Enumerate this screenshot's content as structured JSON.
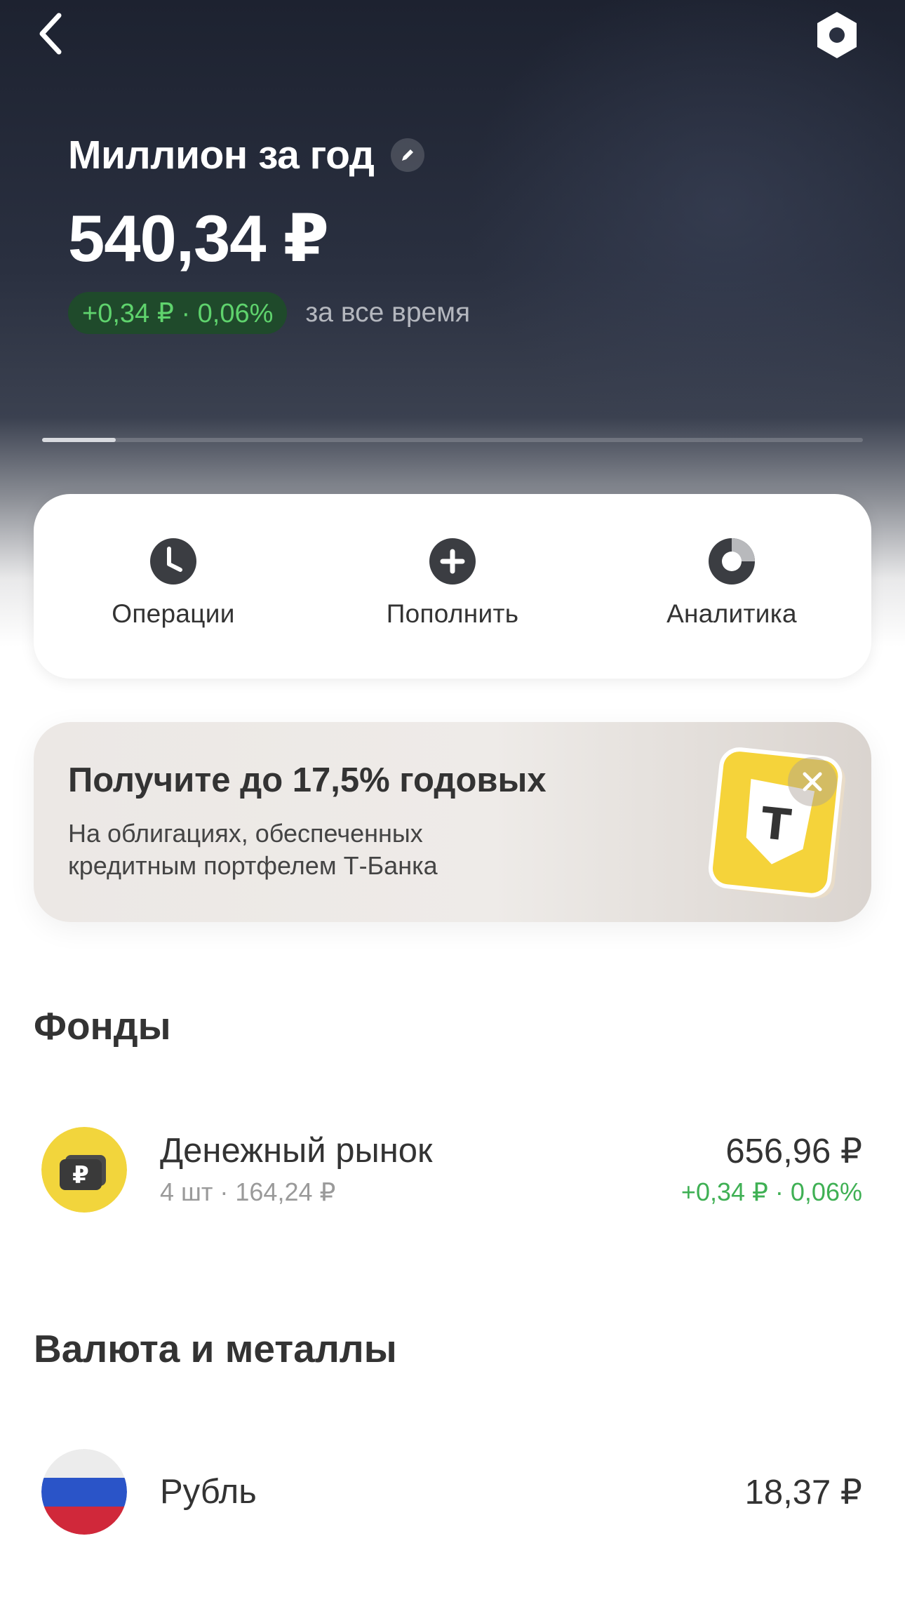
{
  "header": {
    "back_icon": "chevron-left-icon",
    "settings_icon": "hexagon-settings-icon",
    "title": "Миллион за год",
    "edit_icon": "pencil-icon",
    "balance": "540,34 ₽",
    "yield_badge": "+0,34 ₽ · 0,06%",
    "yield_period": "за все время",
    "progress_fraction": 0.09
  },
  "actions": [
    {
      "label": "Операции",
      "icon": "clock-icon"
    },
    {
      "label": "Пополнить",
      "icon": "plus-icon"
    },
    {
      "label": "Аналитика",
      "icon": "pie-chart-icon"
    }
  ],
  "promo": {
    "title": "Получите до 17,5% годовых",
    "text_line1": "На облигациях, обеспеченных",
    "text_line2": "кредитным портфелем Т-Банка",
    "badge_letter": "T",
    "close_icon": "close-icon"
  },
  "sections": {
    "funds": {
      "title": "Фонды",
      "items": [
        {
          "name": "Денежный рынок",
          "sub": "4 шт · 164,24 ₽",
          "value": "656,96 ₽",
          "change": "+0,34 ₽ · 0,06%",
          "icon": "ruble-wallet-icon"
        }
      ]
    },
    "currency": {
      "title": "Валюта и металлы",
      "items": [
        {
          "name": "Рубль",
          "value": "18,37 ₽",
          "icon": "russia-flag-icon"
        }
      ]
    }
  },
  "colors": {
    "positive": "#3fb054",
    "badge_bg": "#1f4a2b",
    "badge_text": "#5fd36d",
    "hero_dark": "#1d2230",
    "promo_yellow": "#f5d33a"
  }
}
